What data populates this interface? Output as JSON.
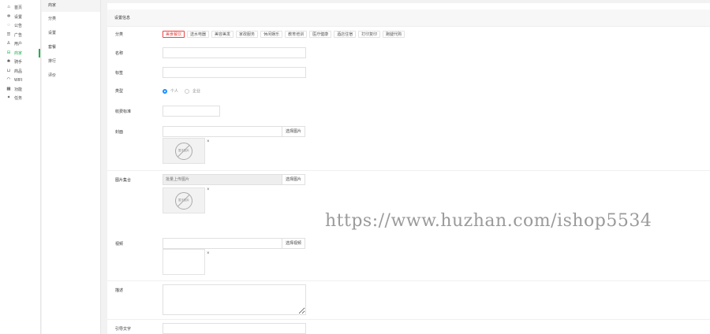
{
  "sidebar": {
    "items": [
      {
        "label": "首页",
        "icon": "home-icon",
        "glyph": "⌂"
      },
      {
        "label": "设置",
        "icon": "gear-icon",
        "glyph": "✲"
      },
      {
        "label": "公告",
        "icon": "bell-icon",
        "glyph": "◌"
      },
      {
        "label": "广告",
        "icon": "ad-icon",
        "glyph": "☰"
      },
      {
        "label": "用户",
        "icon": "user-icon",
        "glyph": "♙"
      },
      {
        "label": "商家",
        "icon": "shop-icon",
        "glyph": "⊟",
        "active": true
      },
      {
        "label": "骑手",
        "icon": "rider-icon",
        "glyph": "❀"
      },
      {
        "label": "商品",
        "icon": "cart-icon",
        "glyph": "⊔"
      },
      {
        "label": "WIFI",
        "icon": "wifi-icon",
        "glyph": "◠"
      },
      {
        "label": "功能",
        "icon": "grid-icon",
        "glyph": "▦"
      },
      {
        "label": "任务",
        "icon": "task-icon",
        "glyph": "✦"
      }
    ]
  },
  "subnav": {
    "items": [
      {
        "label": "商家",
        "active": true
      },
      {
        "label": "分类"
      },
      {
        "label": "设置"
      },
      {
        "label": "套餐"
      },
      {
        "label": "排行"
      },
      {
        "label": "评价"
      }
    ]
  },
  "panel": {
    "title": "设置信息"
  },
  "form": {
    "category_label": "分类",
    "categories": [
      "美食餐饮",
      "送水电器",
      "美容美发",
      "家政服务",
      "休闲娱乐",
      "教育培训",
      "医疗健康",
      "酒店住宿",
      "打印复印",
      "跑腿代购"
    ],
    "name_label": "名称",
    "name_value": "",
    "tag_label": "标签",
    "tag_value": "",
    "type_label": "类型",
    "type_options": [
      "个人",
      "企业"
    ],
    "fee_label": "收费标准",
    "fee_value": "",
    "cover_label": "封面",
    "cover_btn": "选择图片",
    "noimg_text": "暂无图片",
    "gallery_label": "图片集合",
    "gallery_placeholder": "批量上传图片",
    "gallery_btn": "选择图片",
    "video_label": "视频",
    "video_btn": "选择视频",
    "desc_label": "描述",
    "intro_label": "引导文字"
  },
  "close_glyph": "×",
  "watermark": "https://www.huzhan.com/ishop5534",
  "colors": {
    "accent": "#22b14c",
    "selected_chip": "#e44444",
    "radio": "#1e90ff"
  }
}
